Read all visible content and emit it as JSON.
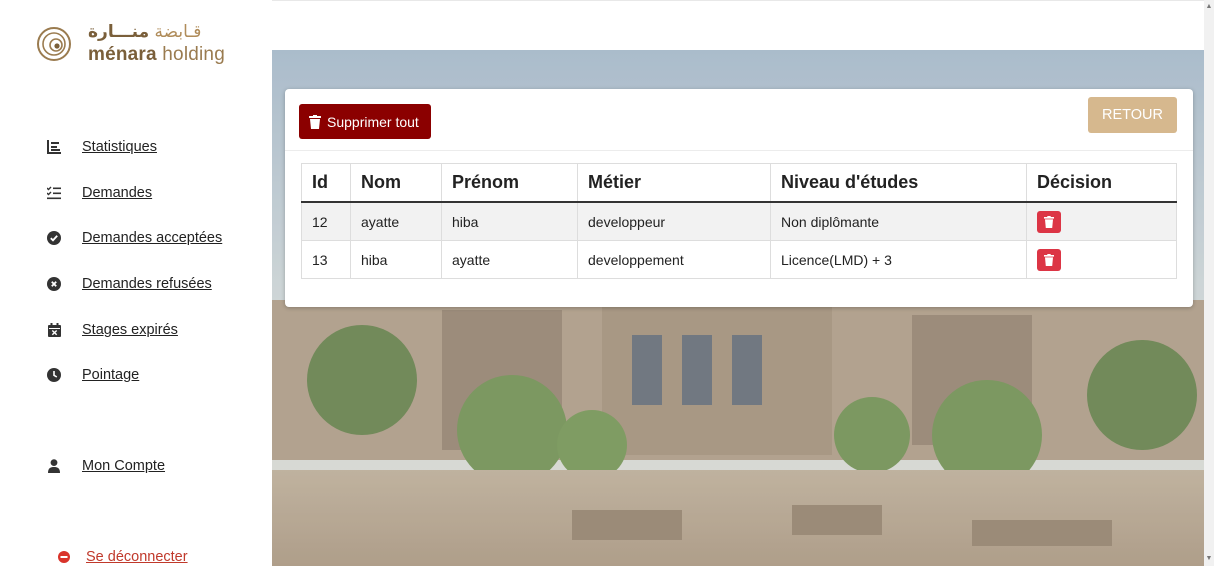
{
  "brand": {
    "arabic_bold": "منـــارة",
    "arabic_light": "قـابضة",
    "name_bold": "ménara",
    "name_light": "holding"
  },
  "sidebar": {
    "items": [
      {
        "label": "Statistiques",
        "icon": "list-chart-icon"
      },
      {
        "label": "Demandes",
        "icon": "checklist-icon"
      },
      {
        "label": "Demandes acceptées",
        "icon": "check-circle-icon"
      },
      {
        "label": "Demandes refusées",
        "icon": "x-circle-icon"
      },
      {
        "label": "Stages expirés",
        "icon": "calendar-x-icon"
      },
      {
        "label": "Pointage",
        "icon": "clock-icon"
      }
    ],
    "account": {
      "label": "Mon Compte",
      "icon": "user-icon"
    },
    "logout": {
      "label": "Se déconnecter",
      "icon": "logout-icon"
    }
  },
  "toolbar": {
    "delete_all_label": "Supprimer tout",
    "back_label": "RETOUR"
  },
  "table": {
    "headers": [
      "Id",
      "Nom",
      "Prénom",
      "Métier",
      "Niveau d'études",
      "Décision"
    ],
    "rows": [
      {
        "id": "12",
        "nom": "ayatte",
        "prenom": "hiba",
        "metier": "developpeur",
        "niveau": "Non diplômante"
      },
      {
        "id": "13",
        "nom": "hiba",
        "prenom": "ayatte",
        "metier": "developpement",
        "niveau": "Licence(LMD) + 3"
      }
    ]
  },
  "colors": {
    "delete_all_bg": "#8b0000",
    "back_bg": "#d6b88e",
    "trash_bg": "#dc3545",
    "brand": "#9a7b4f"
  }
}
